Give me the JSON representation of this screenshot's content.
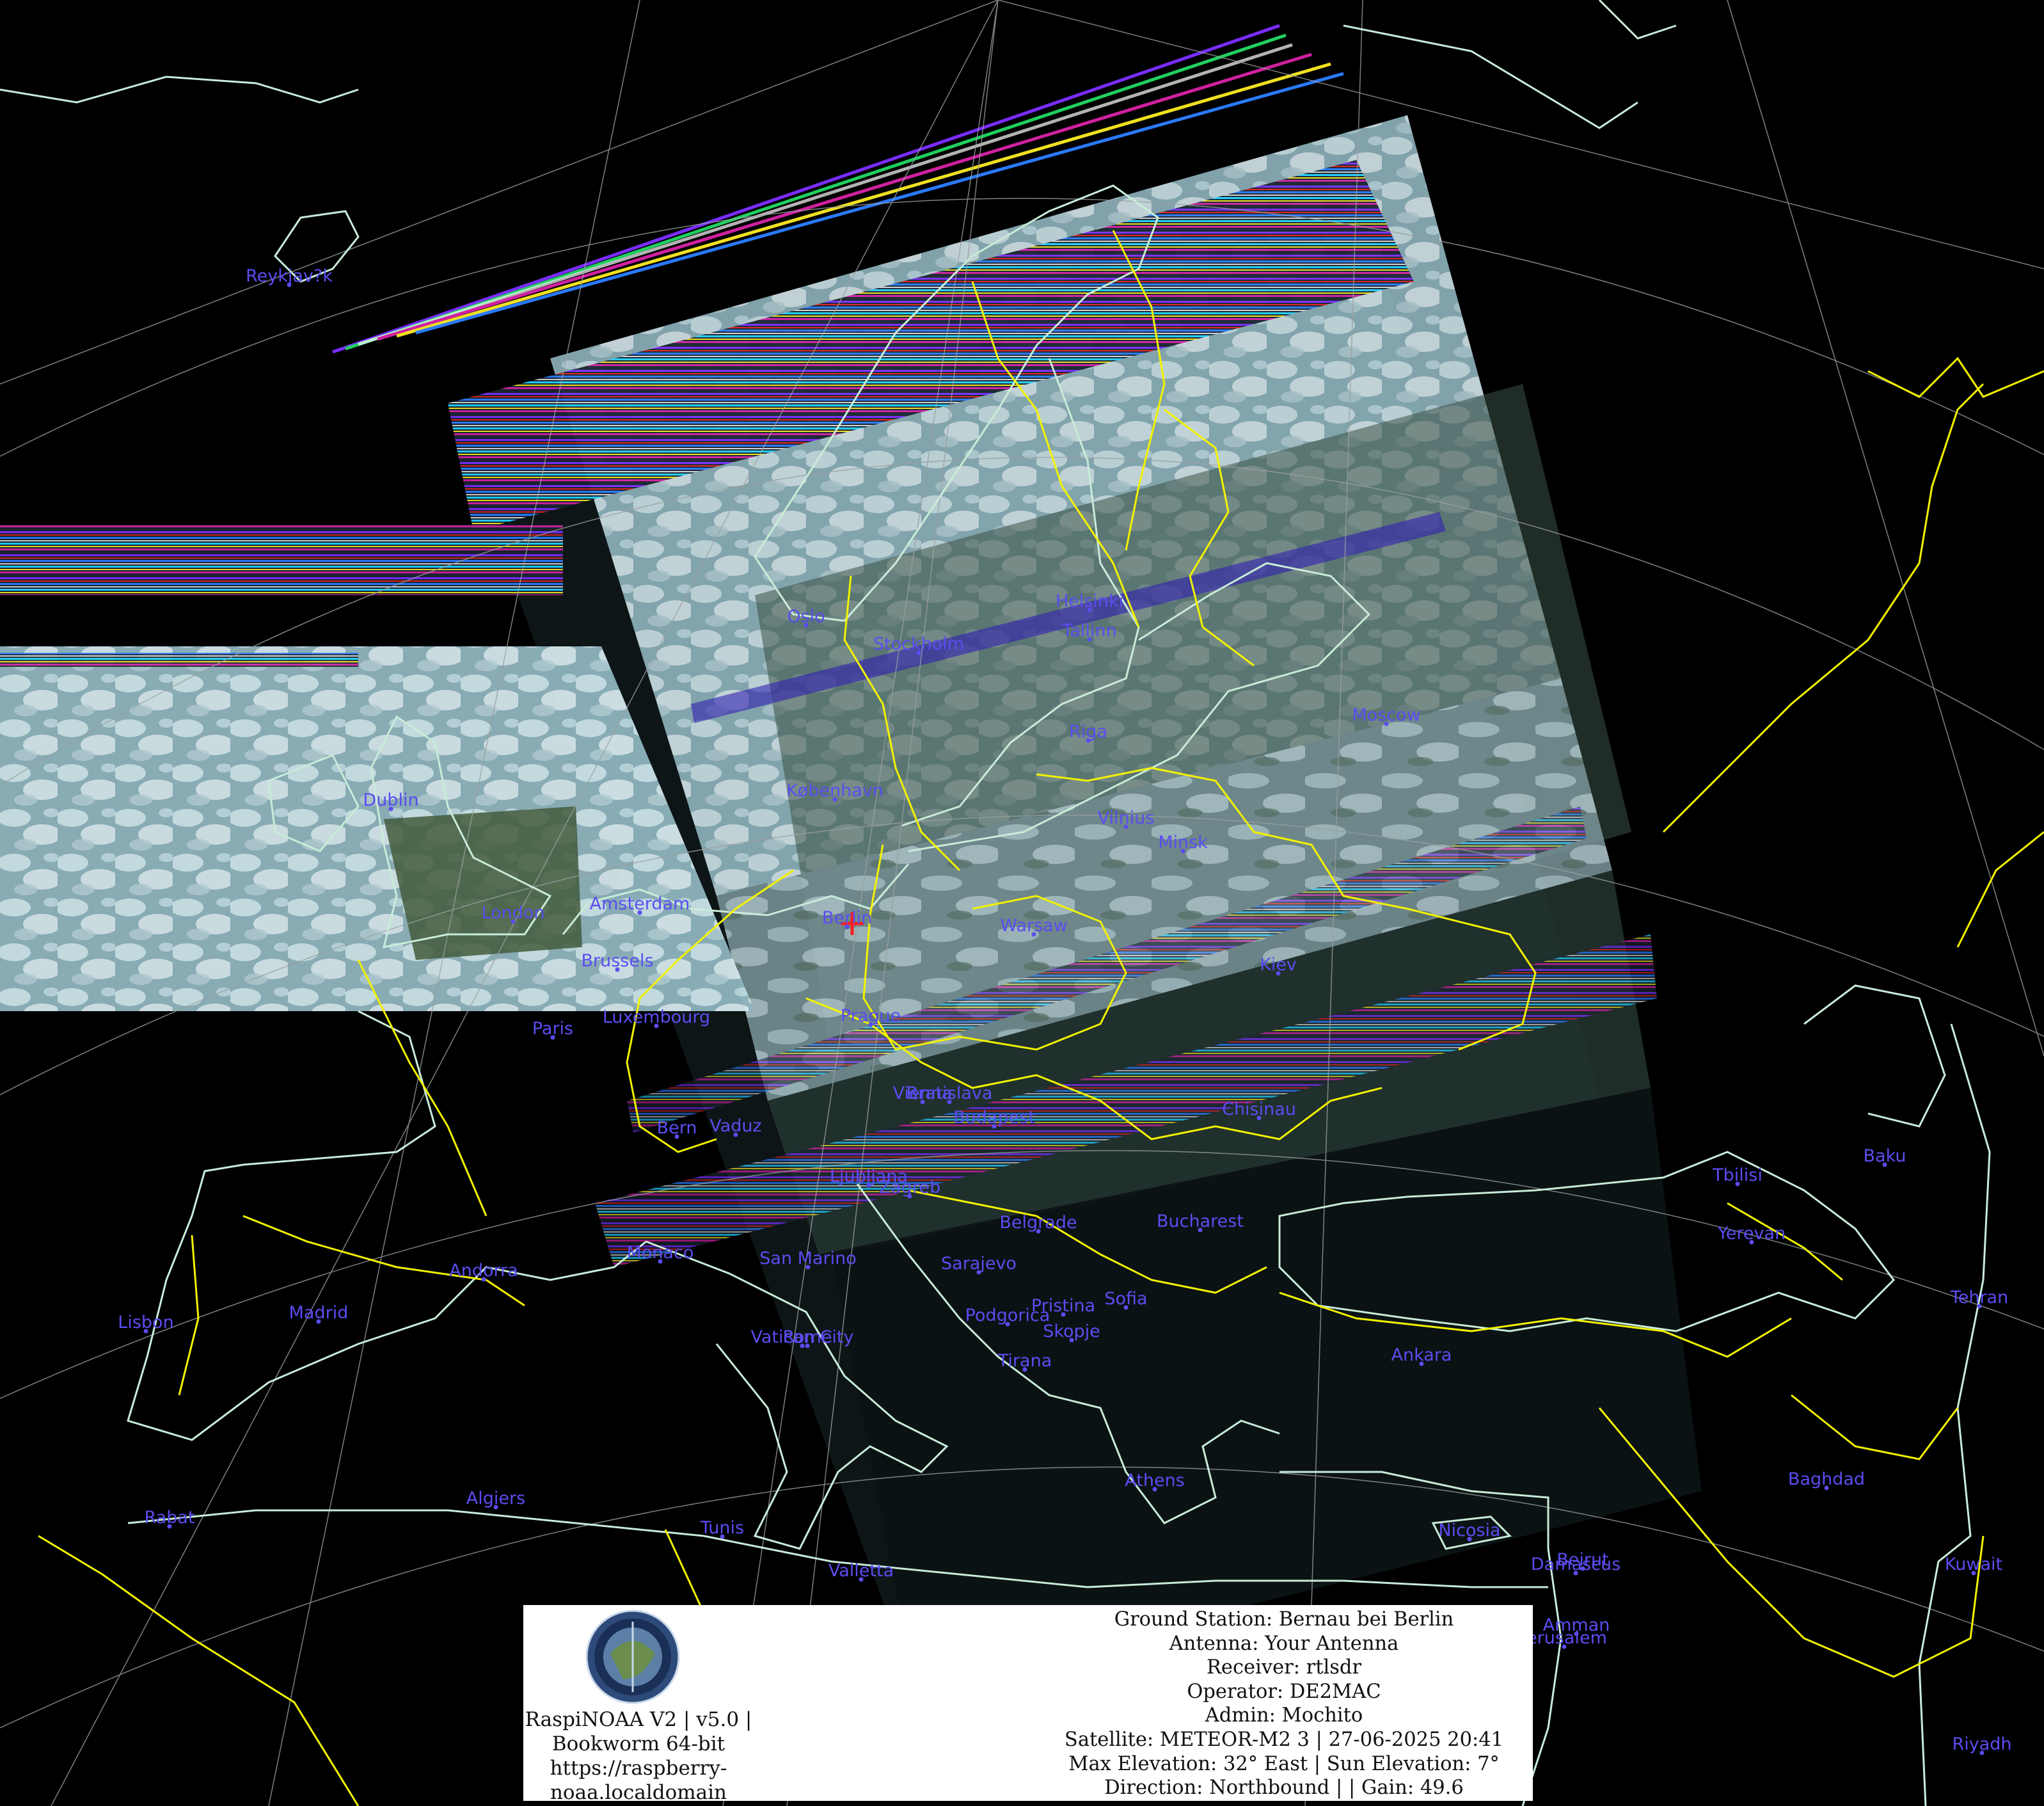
{
  "map": {
    "colors": {
      "background": "#000000",
      "coastline": "#c8ecd8",
      "border": "#f2f200",
      "graticule": "#9aa0a0",
      "label": "#5b4df0",
      "marker": "#ff2020",
      "cloud": "#cfe6ee",
      "land": "#3f5436"
    },
    "ground_station_marker": "Berlin",
    "cities": [
      {
        "name": "Reykjav?k"
      },
      {
        "name": "Oslo"
      },
      {
        "name": "Helsinki"
      },
      {
        "name": "Tallinn"
      },
      {
        "name": "Stockholm"
      },
      {
        "name": "Moscow"
      },
      {
        "name": "Riga"
      },
      {
        "name": "København"
      },
      {
        "name": "Vilnius"
      },
      {
        "name": "Minsk"
      },
      {
        "name": "Dublin"
      },
      {
        "name": "London"
      },
      {
        "name": "Amsterdam"
      },
      {
        "name": "Berlin"
      },
      {
        "name": "Warsaw"
      },
      {
        "name": "Brussels"
      },
      {
        "name": "Kiev"
      },
      {
        "name": "Luxembourg"
      },
      {
        "name": "Prague"
      },
      {
        "name": "Paris"
      },
      {
        "name": "Vienna"
      },
      {
        "name": "Bratislava"
      },
      {
        "name": "Budapest"
      },
      {
        "name": "Chisinau"
      },
      {
        "name": "Bern"
      },
      {
        "name": "Vaduz"
      },
      {
        "name": "Ljubljana"
      },
      {
        "name": "Zagreb"
      },
      {
        "name": "Tbilisi"
      },
      {
        "name": "Baku"
      },
      {
        "name": "Belgrade"
      },
      {
        "name": "Bucharest"
      },
      {
        "name": "Yerevan"
      },
      {
        "name": "Monaco"
      },
      {
        "name": "San Marino"
      },
      {
        "name": "Andorra"
      },
      {
        "name": "Sarajevo"
      },
      {
        "name": "Pristina"
      },
      {
        "name": "Sofia"
      },
      {
        "name": "Tehran"
      },
      {
        "name": "Lisbon"
      },
      {
        "name": "Madrid"
      },
      {
        "name": "Podgorica"
      },
      {
        "name": "Skopje"
      },
      {
        "name": "Vatican City"
      },
      {
        "name": "Rome"
      },
      {
        "name": "Tirana"
      },
      {
        "name": "Ankara"
      },
      {
        "name": "Athens"
      },
      {
        "name": "Baghdad"
      },
      {
        "name": "Algiers"
      },
      {
        "name": "Rabat"
      },
      {
        "name": "Tunis"
      },
      {
        "name": "Nicosia"
      },
      {
        "name": "Beirut"
      },
      {
        "name": "Damascus"
      },
      {
        "name": "Kuwait"
      },
      {
        "name": "Valletta"
      },
      {
        "name": "Amman"
      },
      {
        "name": "Jerusalem"
      },
      {
        "name": "Riyadh"
      }
    ]
  },
  "info": {
    "logo": "logo-icon",
    "software": [
      "RaspiNOAA V2 | v5.0 |",
      "Bookworm 64-bit",
      "https://raspberry-",
      "noaa.localdomain"
    ],
    "station": [
      "Ground Station: Bernau bei Berlin",
      "Antenna: Your Antenna",
      "Receiver: rtlsdr",
      "Operator: DE2MAC",
      "Admin: Mochito",
      "Satellite: METEOR-M2 3 | 27-06-2025 20:41",
      "Max Elevation: 32° East | Sun Elevation: 7°",
      "Direction: Northbound | | Gain: 49.6"
    ]
  }
}
